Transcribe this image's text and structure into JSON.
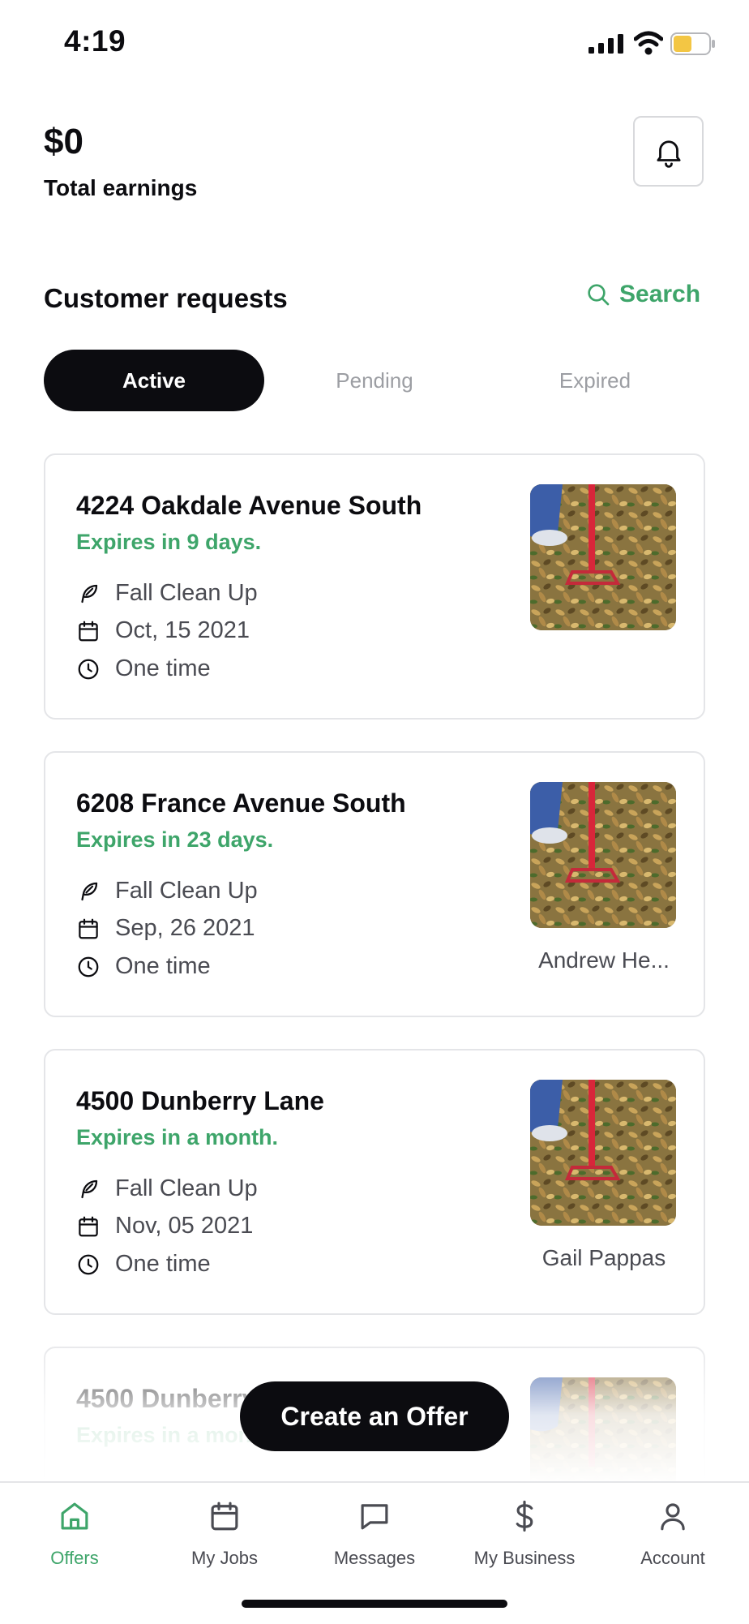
{
  "status_bar": {
    "time": "4:19"
  },
  "header": {
    "earnings_value": "$0",
    "earnings_label": "Total earnings"
  },
  "requests": {
    "title": "Customer requests",
    "search_label": "Search",
    "tabs": [
      {
        "label": "Active",
        "active": true
      },
      {
        "label": "Pending",
        "active": false
      },
      {
        "label": "Expired",
        "active": false
      }
    ],
    "cards": [
      {
        "address": "4224 Oakdale Avenue South",
        "expires": "Expires in 9 days.",
        "service": "Fall Clean Up",
        "date": "Oct, 15 2021",
        "frequency": "One time",
        "customer": ""
      },
      {
        "address": "6208 France Avenue South",
        "expires": "Expires in 23 days.",
        "service": "Fall Clean Up",
        "date": "Sep, 26 2021",
        "frequency": "One time",
        "customer": "Andrew He..."
      },
      {
        "address": "4500 Dunberry Lane",
        "expires": "Expires in a month.",
        "service": "Fall Clean Up",
        "date": "Nov, 05 2021",
        "frequency": "One time",
        "customer": "Gail Pappas"
      },
      {
        "address": "4500 Dunberry Lane",
        "expires": "Expires in a month.",
        "service": "",
        "date": "",
        "frequency": "",
        "customer": ""
      }
    ]
  },
  "cta_label": "Create an Offer",
  "nav": [
    {
      "label": "Offers",
      "icon": "home-icon",
      "active": true
    },
    {
      "label": "My Jobs",
      "icon": "calendar-icon",
      "active": false
    },
    {
      "label": "Messages",
      "icon": "message-icon",
      "active": false
    },
    {
      "label": "My Business",
      "icon": "dollar-icon",
      "active": false
    },
    {
      "label": "Account",
      "icon": "user-icon",
      "active": false
    }
  ],
  "colors": {
    "accent": "#3ea56a",
    "dark": "#0c0c10",
    "battery": "#f3c644"
  }
}
